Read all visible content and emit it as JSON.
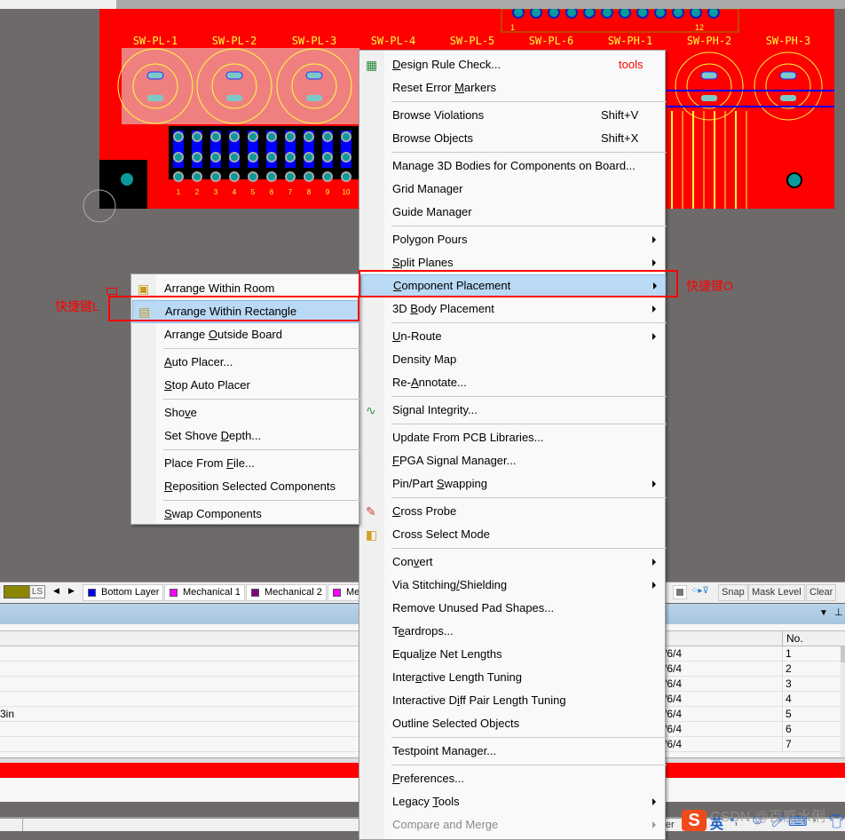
{
  "colors": {
    "board": "#ff0000",
    "canvas": "#6e6a6a",
    "highlight": "#b9d9f5",
    "annotation": "#ff0000",
    "pad": "#0a9a9a",
    "bottom_layer": "#0000ff",
    "mechanical1": "#ff00ff",
    "mechanical2": "#800080"
  },
  "pcb": {
    "designators": [
      "SW-PL-1",
      "SW-PL-2",
      "SW-PL-3",
      "SW-PL-4",
      "SW-PL-5",
      "SW-PL-6",
      "SW-PH-1",
      "SW-PH-2",
      "SW-PH-3"
    ],
    "header_pins": [
      "1",
      "2",
      "3",
      "4",
      "5",
      "6",
      "7",
      "8",
      "9",
      "10"
    ],
    "connector_pin_first": "1",
    "connector_pin_last": "12"
  },
  "tools_menu": {
    "annotation": "tools",
    "items": [
      {
        "label": "Design Rule Check...",
        "mn": 0,
        "icon": "drc-icon"
      },
      {
        "label": "Reset Error Markers",
        "mn": 12
      },
      {
        "sep": true
      },
      {
        "label": "Browse Violations",
        "shortcut": "Shift+V"
      },
      {
        "label": "Browse Objects",
        "shortcut": "Shift+X"
      },
      {
        "sep": true
      },
      {
        "label": "Manage 3D Bodies for Components on Board..."
      },
      {
        "label": "Grid Manager"
      },
      {
        "label": "Guide Manager"
      },
      {
        "sep": true
      },
      {
        "label": "Polygon Pours",
        "sub": true
      },
      {
        "label": "Split Planes",
        "sub": true,
        "mn": 0
      },
      {
        "label": "Component Placement",
        "sub": true,
        "mn": 0,
        "hl": true
      },
      {
        "label": "3D Body Placement",
        "sub": true,
        "mn": 3
      },
      {
        "sep": true
      },
      {
        "label": "Un-Route",
        "sub": true,
        "mn": 0
      },
      {
        "label": "Density Map"
      },
      {
        "label": "Re-Annotate...",
        "mn": 3
      },
      {
        "sep": true
      },
      {
        "label": "Signal Integrity...",
        "icon": "signal-integrity-icon"
      },
      {
        "sep": true
      },
      {
        "label": "Update From PCB Libraries..."
      },
      {
        "label": "FPGA Signal Manager...",
        "mn": 0
      },
      {
        "label": "Pin/Part Swapping",
        "sub": true,
        "mn": 9
      },
      {
        "sep": true
      },
      {
        "label": "Cross Probe",
        "mn": 0,
        "icon": "cross-probe-icon"
      },
      {
        "label": "Cross Select Mode",
        "icon": "cross-select-icon"
      },
      {
        "sep": true
      },
      {
        "label": "Convert",
        "sub": true,
        "mn": 3
      },
      {
        "label": "Via Stitching/Shielding",
        "sub": true,
        "mn": 13
      },
      {
        "label": "Remove Unused Pad Shapes..."
      },
      {
        "label": "Teardrops...",
        "mn": 1
      },
      {
        "label": "Equalize Net Lengths",
        "mn": 5
      },
      {
        "label": "Interactive Length Tuning",
        "mn": 5
      },
      {
        "label": "Interactive Diff Pair Length Tuning",
        "mn": 13
      },
      {
        "label": "Outline Selected Objects",
        "mn": 19
      },
      {
        "sep": true
      },
      {
        "label": "Testpoint Manager..."
      },
      {
        "sep": true
      },
      {
        "label": "Preferences...",
        "mn": 0
      },
      {
        "label": "Legacy Tools",
        "sub": true,
        "mn": 7
      },
      {
        "label": "Compare and Merge",
        "sub": true,
        "disabled": true
      }
    ]
  },
  "placement_menu": {
    "items": [
      {
        "label": "Arrange Within Room",
        "icon": "arrange-room-icon"
      },
      {
        "label": "Arrange Within Rectangle",
        "icon": "arrange-rectangle-icon",
        "hl": true
      },
      {
        "label": "Arrange Outside Board",
        "mn": 8
      },
      {
        "sep": true
      },
      {
        "label": "Auto Placer...",
        "mn": 0
      },
      {
        "label": "Stop Auto Placer",
        "mn": 0
      },
      {
        "sep": true
      },
      {
        "label": "Shove",
        "mn": 3
      },
      {
        "label": "Set Shove Depth...",
        "mn": 10
      },
      {
        "sep": true
      },
      {
        "label": "Place From File...",
        "mn": 11
      },
      {
        "label": "Reposition Selected Components",
        "mn": 0
      },
      {
        "sep": true
      },
      {
        "label": "Swap Components",
        "mn": 0
      }
    ]
  },
  "annotations": {
    "shortcut_o": "快捷键O",
    "shortcut_l": "快捷键L"
  },
  "layer_bar": {
    "ls_label": "LS",
    "tabs": [
      {
        "label": "Bottom Layer",
        "color": "#0000ff"
      },
      {
        "label": "Mechanical 1",
        "color": "#ff00ff"
      },
      {
        "label": "Mechanical 2",
        "color": "#800080"
      },
      {
        "label": "Me",
        "color": "#ff00ff"
      }
    ],
    "snap": "Snap",
    "mask_level": "Mask Level",
    "clear": "Clear"
  },
  "panel": {
    "col_no": "No.",
    "rows": [
      {
        "left": "",
        "mid": "/6/4",
        "no": "1"
      },
      {
        "left": "",
        "mid": "/6/4",
        "no": "2"
      },
      {
        "left": "",
        "mid": "/6/4",
        "no": "3"
      },
      {
        "left": "",
        "mid": "/6/4",
        "no": "4"
      },
      {
        "left": "3in",
        "mid": "/6/4",
        "no": "5"
      },
      {
        "left": "",
        "mid": "/6/4",
        "no": "6"
      },
      {
        "left": "",
        "mid": "/6/4",
        "no": "7"
      }
    ]
  },
  "status": {
    "fragment": "iler",
    "ime_lang": "英",
    "watermark": "CSDN @百感水俐"
  }
}
